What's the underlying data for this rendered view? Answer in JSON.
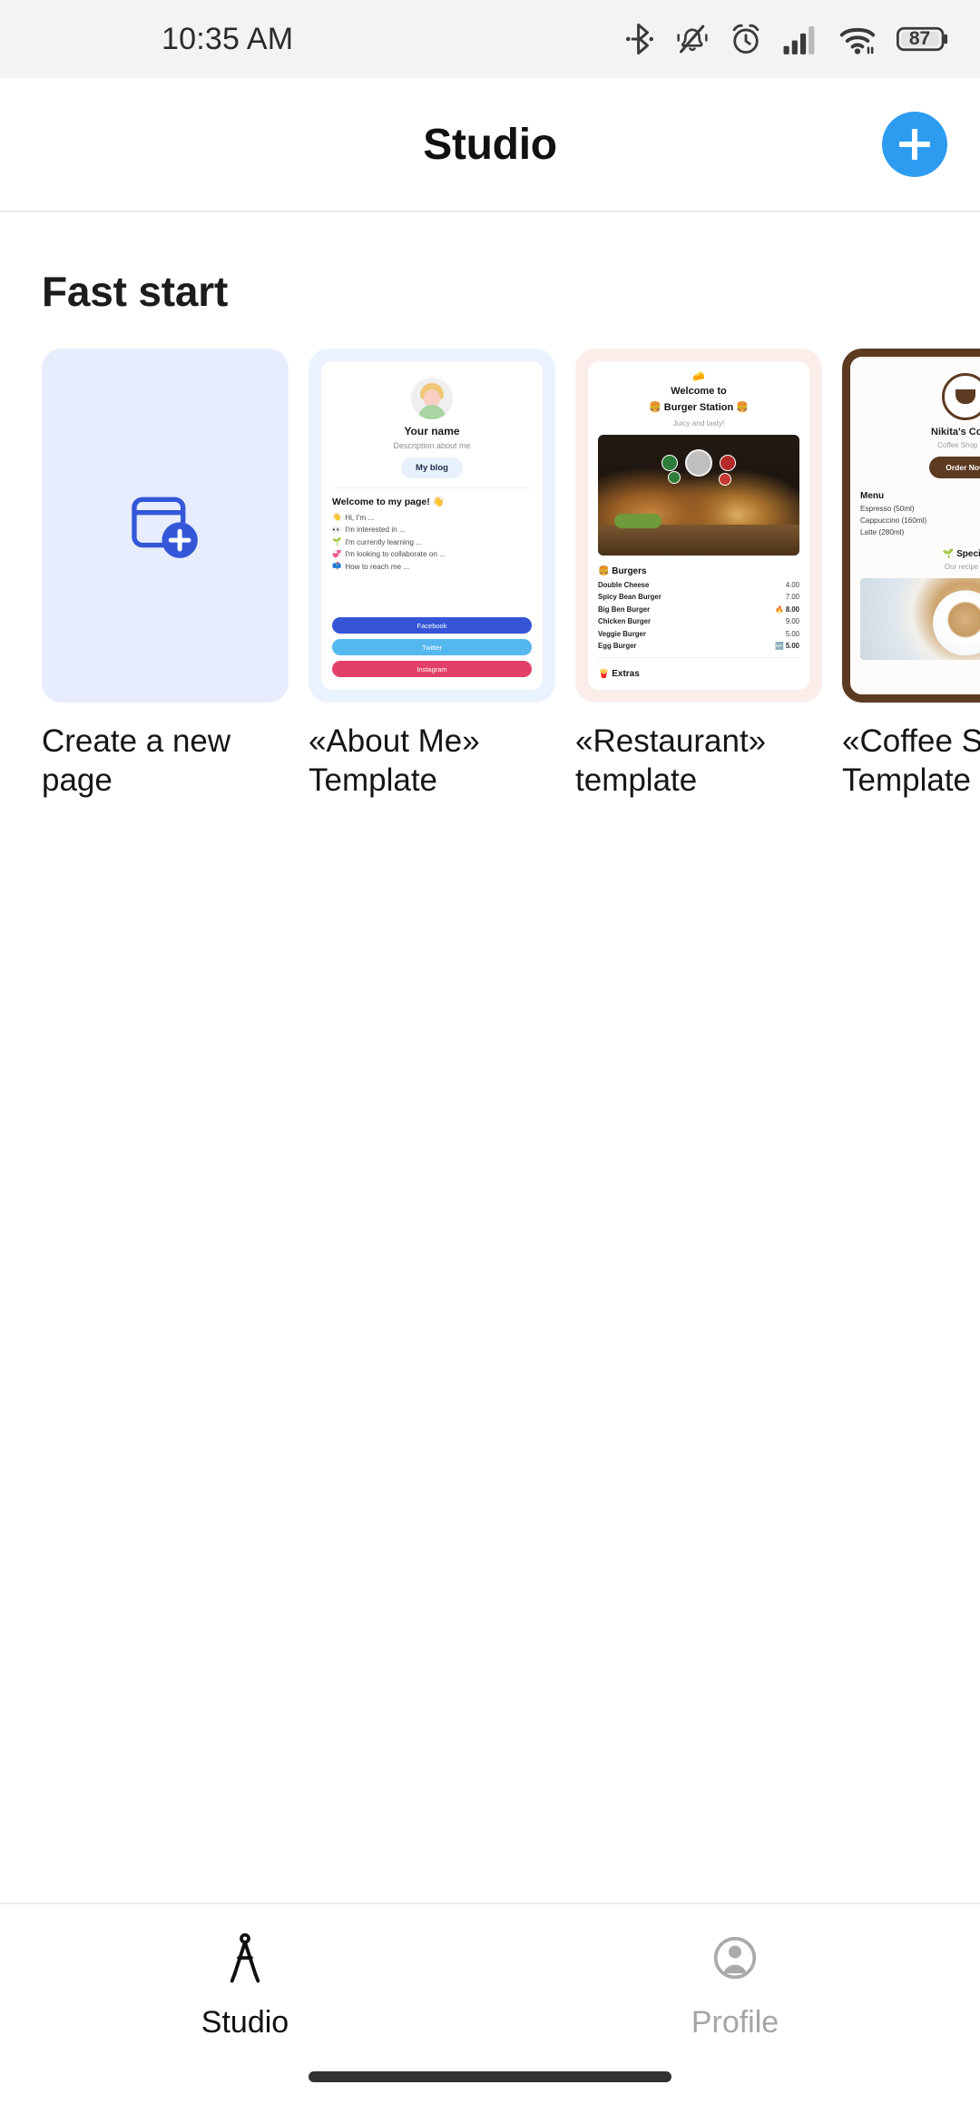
{
  "status_bar": {
    "time": "10:35 AM",
    "battery_percent": "87",
    "icons": [
      "bluetooth-icon",
      "vibrate-off-icon",
      "alarm-icon",
      "signal-icon",
      "wifi-icon",
      "battery-icon"
    ]
  },
  "header": {
    "title": "Studio",
    "add_button_label": "+",
    "accent_color": "#2d9cf0"
  },
  "main": {
    "section_title": "Fast start",
    "cards": [
      {
        "label": "Create a new page",
        "kind": "create-new"
      },
      {
        "label": "«About Me» Template",
        "kind": "about-me"
      },
      {
        "label": "«Restaurant» template",
        "kind": "restaurant"
      },
      {
        "label": "«Coffee Shop» Template",
        "kind": "coffee-shop"
      }
    ]
  },
  "about_preview": {
    "name": "Your name",
    "description": "Description about me",
    "blog_button": "My blog",
    "welcome": "Welcome to my page! 👋",
    "list": [
      {
        "emoji": "👋",
        "text": "Hi, I'm ..."
      },
      {
        "emoji": "👀",
        "text": "I'm interested in ..."
      },
      {
        "emoji": "🌱",
        "text": "I'm currently learning ..."
      },
      {
        "emoji": "💞",
        "text": "I'm looking to collaborate on ..."
      },
      {
        "emoji": "📫",
        "text": "How to reach me ..."
      }
    ],
    "social": [
      {
        "label": "Facebook",
        "color": "#3554d8"
      },
      {
        "label": "Twitter",
        "color": "#54b8ef"
      },
      {
        "label": "Instagram",
        "color": "#e34068"
      }
    ]
  },
  "restaurant_preview": {
    "top_emoji": "🧀",
    "title_line1": "Welcome to",
    "title_line2": "🍔 Burger Station 🍔",
    "subtitle": "Juicy and tasty!",
    "section_burgers": "🍔 Burgers",
    "section_extras": "🍟 Extras",
    "menu": [
      {
        "name": "Double Cheese",
        "price": "4.00",
        "tag": ""
      },
      {
        "name": "Spicy Bean Burger",
        "price": "7.00",
        "tag": ""
      },
      {
        "name": "Big Ben Burger",
        "price": "8.00",
        "tag": "🔥"
      },
      {
        "name": "Chicken Burger",
        "price": "9.00",
        "tag": ""
      },
      {
        "name": "Veggie Burger",
        "price": "5.00",
        "tag": ""
      },
      {
        "name": "Egg Burger",
        "price": "5.00",
        "tag": "🆕"
      }
    ]
  },
  "coffee_preview": {
    "title": "Nikita's Coffee",
    "subtitle": "Coffee Shop in ...",
    "order_button": "Order Now",
    "menu_title": "Menu",
    "menu": [
      "Espresso (50ml)",
      "Cappuccino (160ml)",
      "Latte (280ml)"
    ],
    "special_title": "🌱 Special",
    "special_subtitle": "Our recipe ..."
  },
  "bottom_nav": {
    "items": [
      {
        "label": "Studio",
        "icon": "compass-divider-icon",
        "active": true
      },
      {
        "label": "Profile",
        "icon": "person-circle-icon",
        "active": false
      }
    ]
  }
}
